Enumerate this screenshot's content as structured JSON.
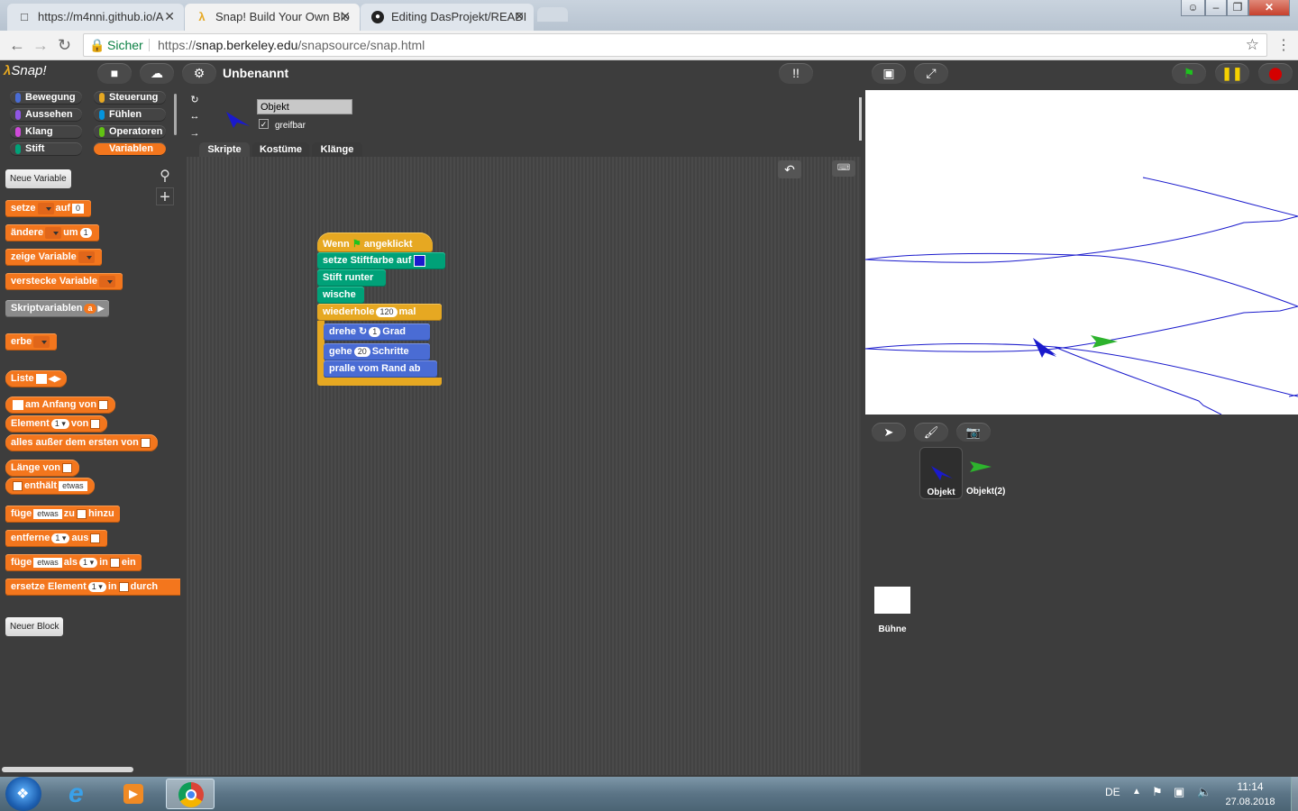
{
  "browser": {
    "tabs": [
      {
        "title": "https://m4nni.github.io/A",
        "icon": "page-icon"
      },
      {
        "title": "Snap! Build Your Own Blo",
        "icon": "lambda-icon"
      },
      {
        "title": "Editing DasProjekt/READI",
        "icon": "github-icon"
      }
    ],
    "secure_label": "Sicher",
    "url_prefix": "https://",
    "url_host": "snap.berkeley.edu",
    "url_path": "/snapsource/snap.html"
  },
  "snap": {
    "logo": "Snap!",
    "project_name": "Unbenannt",
    "categories": [
      {
        "label": "Bewegung",
        "color": "#4a6cd4"
      },
      {
        "label": "Steuerung",
        "color": "#e6a822"
      },
      {
        "label": "Aussehen",
        "color": "#8f56e3"
      },
      {
        "label": "Fühlen",
        "color": "#0494dc"
      },
      {
        "label": "Klang",
        "color": "#cf4ad9"
      },
      {
        "label": "Operatoren",
        "color": "#62c213"
      },
      {
        "label": "Stift",
        "color": "#00a178"
      },
      {
        "label": "Variablen",
        "color": "#f3761d"
      }
    ],
    "palette": {
      "new_variable": "Neue Variable",
      "new_block": "Neuer Block",
      "b_setze": "setze",
      "b_auf": "auf",
      "b_auf_val": "0",
      "b_aendere": "ändere",
      "b_um": "um",
      "b_um_val": "1",
      "b_zeige": "zeige Variable",
      "b_verstecke": "verstecke Variable",
      "b_skriptvar": "Skriptvariablen",
      "b_skriptvar_a": "a",
      "b_erbe": "erbe",
      "b_liste": "Liste",
      "b_am_anfang": "am Anfang von",
      "b_element": "Element",
      "b_element_val": "1",
      "b_von": "von",
      "b_alles": "alles außer dem ersten von",
      "b_laenge": "Länge von",
      "b_enthaelt": "enthält",
      "b_etwas": "etwas",
      "b_fuege": "füge",
      "b_zu": "zu",
      "b_hinzu": "hinzu",
      "b_entferne": "entferne",
      "b_aus": "aus",
      "b_fuege2_als": "als",
      "b_in": "in",
      "b_ein": "ein",
      "b_ersetze": "ersetze Element",
      "b_durch": "durch"
    },
    "sprite": {
      "name": "Objekt",
      "draggable_label": "greifbar",
      "tabs": [
        "Skripte",
        "Kostüme",
        "Klänge"
      ]
    },
    "script": {
      "hat_wenn": "Wenn",
      "hat_angeklickt": "angeklickt",
      "pen_color": "setze Stiftfarbe auf",
      "pen_color_value": "#1a1acc",
      "pen_down": "Stift runter",
      "clear": "wische",
      "repeat": "wiederhole",
      "repeat_count": "120",
      "repeat_mal": "mal",
      "turn": "drehe",
      "turn_deg": "1",
      "turn_unit": "Grad",
      "move": "gehe",
      "move_steps": "20",
      "move_unit": "Schritte",
      "bounce": "pralle vom Rand ab"
    },
    "corral": {
      "sprites": [
        {
          "name": "Objekt",
          "selected": true
        },
        {
          "name": "Objekt(2)",
          "selected": false
        }
      ],
      "stage_label": "Bühne"
    }
  },
  "taskbar": {
    "language": "DE",
    "time": "11:14",
    "date": "27.08.2018"
  }
}
